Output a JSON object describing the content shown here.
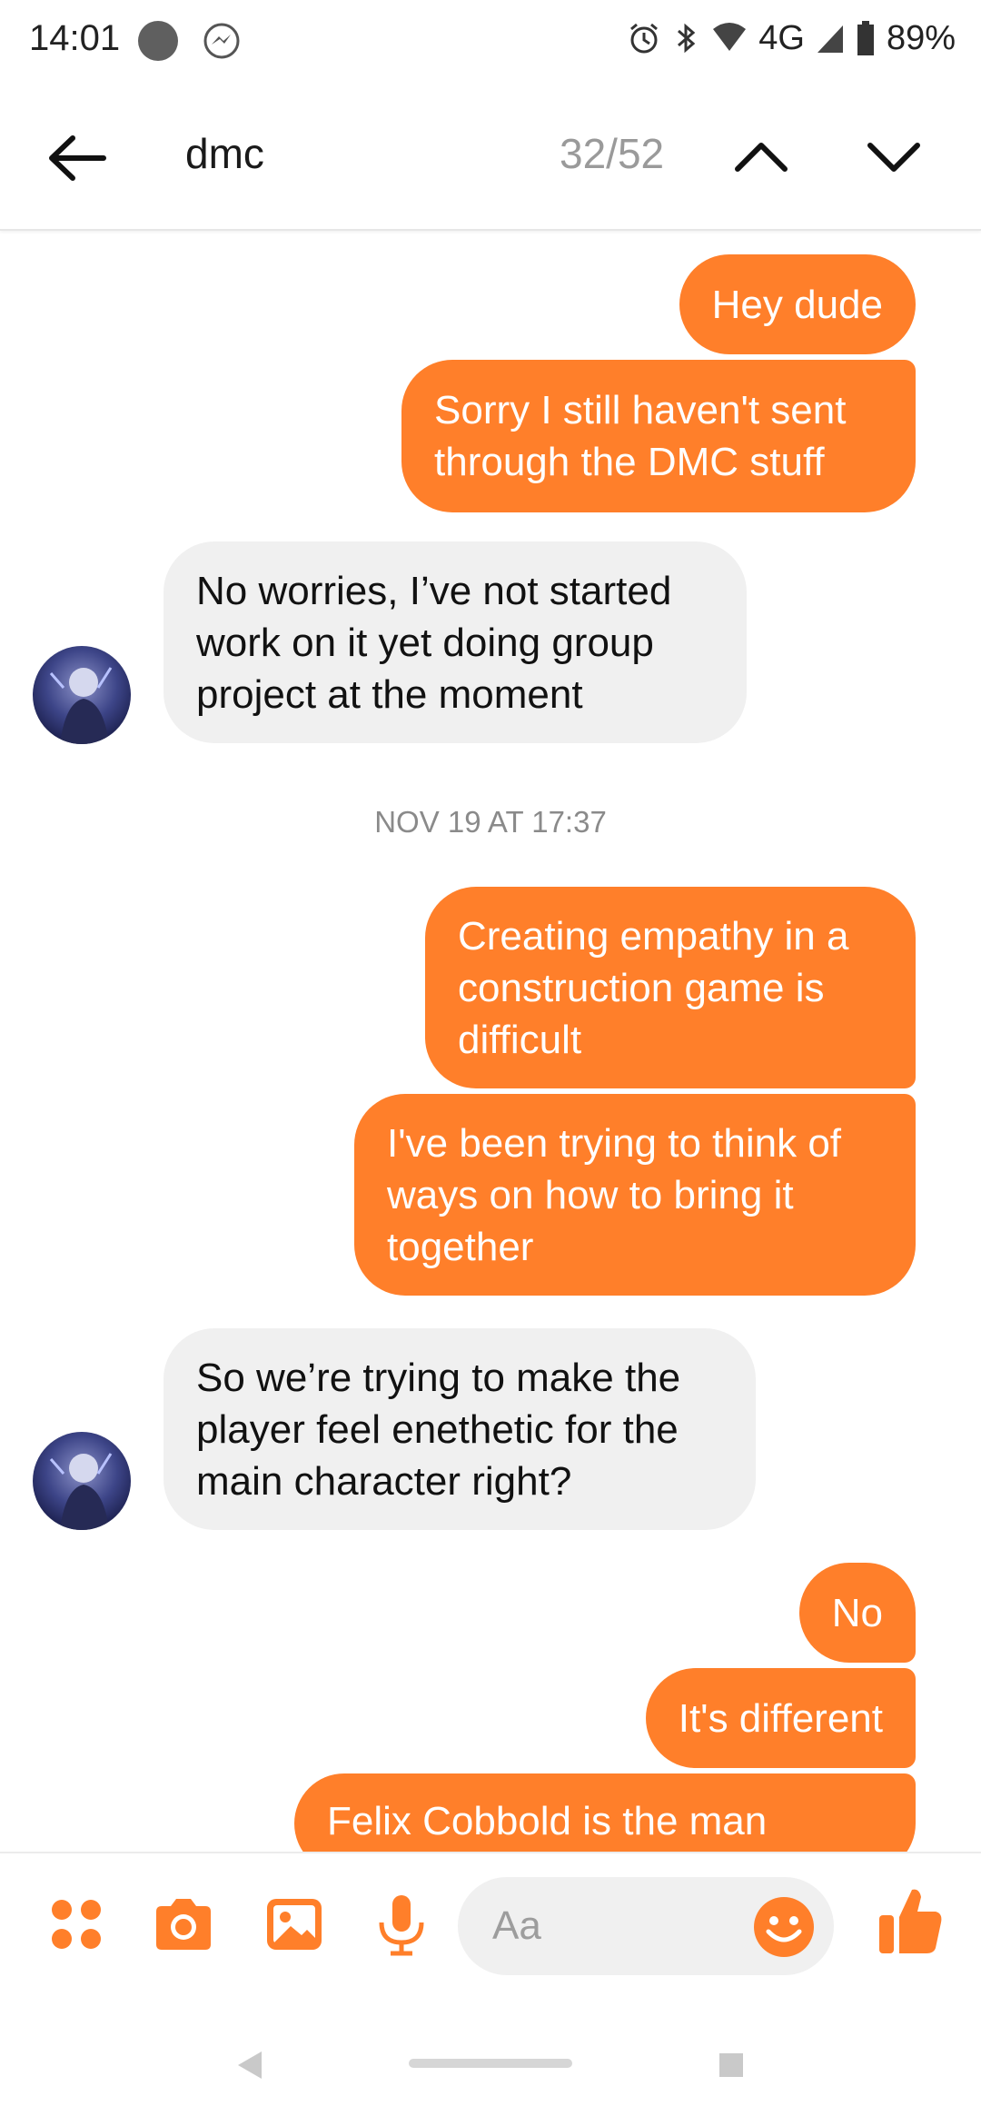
{
  "status_bar": {
    "time": "14:01",
    "network": "4G",
    "battery": "89%"
  },
  "header": {
    "search_query": "dmc",
    "match_counter": "32/52"
  },
  "conversation": {
    "timestamp": "NOV 19 AT 17:37",
    "messages": [
      {
        "from": "me",
        "text": "Hey dude"
      },
      {
        "from": "me",
        "text": "Sorry I still haven't sent through the DMC stuff"
      },
      {
        "from": "them",
        "text": "No worries, I’ve not started work on it yet doing group project at the moment"
      },
      {
        "from": "me",
        "text": "Creating empathy in a construction game is difficult"
      },
      {
        "from": "me",
        "text": "I've been trying to think of ways on how to bring it together"
      },
      {
        "from": "them",
        "text": "So we’re trying to make the player feel enethetic for the main character right?"
      },
      {
        "from": "me",
        "text": "No"
      },
      {
        "from": "me",
        "text": "It's different"
      },
      {
        "from": "me",
        "text": "Felix Cobbold is the man"
      }
    ]
  },
  "composer": {
    "placeholder": "Aa"
  },
  "colors": {
    "accent": "#ff7f2a",
    "incoming_bubble": "#f0f0f0"
  },
  "icons": [
    "back-arrow-icon",
    "chevron-up-icon",
    "chevron-down-icon",
    "menu-dots-icon",
    "camera-icon",
    "gallery-icon",
    "microphone-icon",
    "emoji-icon",
    "thumbs-up-icon"
  ]
}
